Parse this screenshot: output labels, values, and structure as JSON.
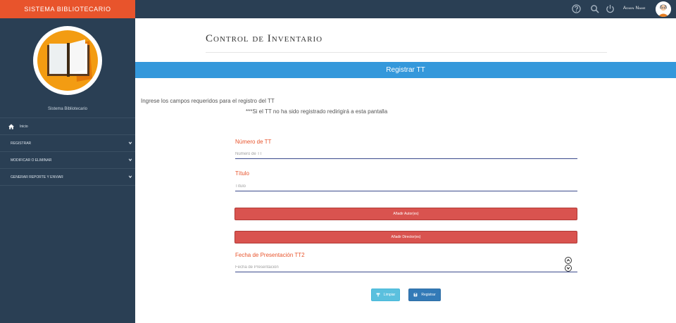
{
  "sidebar": {
    "brand": "SISTEMA BIBLIOTECARIO",
    "subtitle": "Sistema Bibliotecario",
    "items": [
      {
        "label": "Inicio",
        "icon": "home-icon"
      },
      {
        "label": "REGISTRAR",
        "icon": "chevron-down-icon"
      },
      {
        "label": "MODIFICAR O ELIMINAR",
        "icon": "chevron-down-icon"
      },
      {
        "label": "GENERAR REPORTE Y ENVIAR",
        "icon": "chevron-down-icon"
      }
    ]
  },
  "topbar": {
    "icons": [
      "help-icon",
      "search-icon",
      "power-icon"
    ],
    "admin_name": "Admin Name"
  },
  "main": {
    "title": "Control de Inventario",
    "banner": "Registrar TT",
    "intro_line1": "Ingrese los campos requeridos para el registro del TT",
    "intro_line2": "***Si el TT no ha sido registrado redirigirá a esta pantalla",
    "fields": {
      "numero_label": "Número de TT",
      "numero_placeholder": "Número de TT",
      "titulo_label": "Título",
      "titulo_placeholder": "Título",
      "fecha_label": "Fecha de Presentación TT2",
      "fecha_placeholder": "Fecha de Presentación"
    },
    "buttons": {
      "add_author": "Añadir Autor(es)",
      "add_director": "Añadir Director(es)",
      "clear": "Limpiar",
      "register": "Registrar"
    }
  },
  "colors": {
    "sidebar": "#2a3f54",
    "brand": "#e8542c",
    "banner": "#3498db",
    "danger": "#d9534f",
    "info": "#5bc0de",
    "primary": "#337ab7"
  }
}
